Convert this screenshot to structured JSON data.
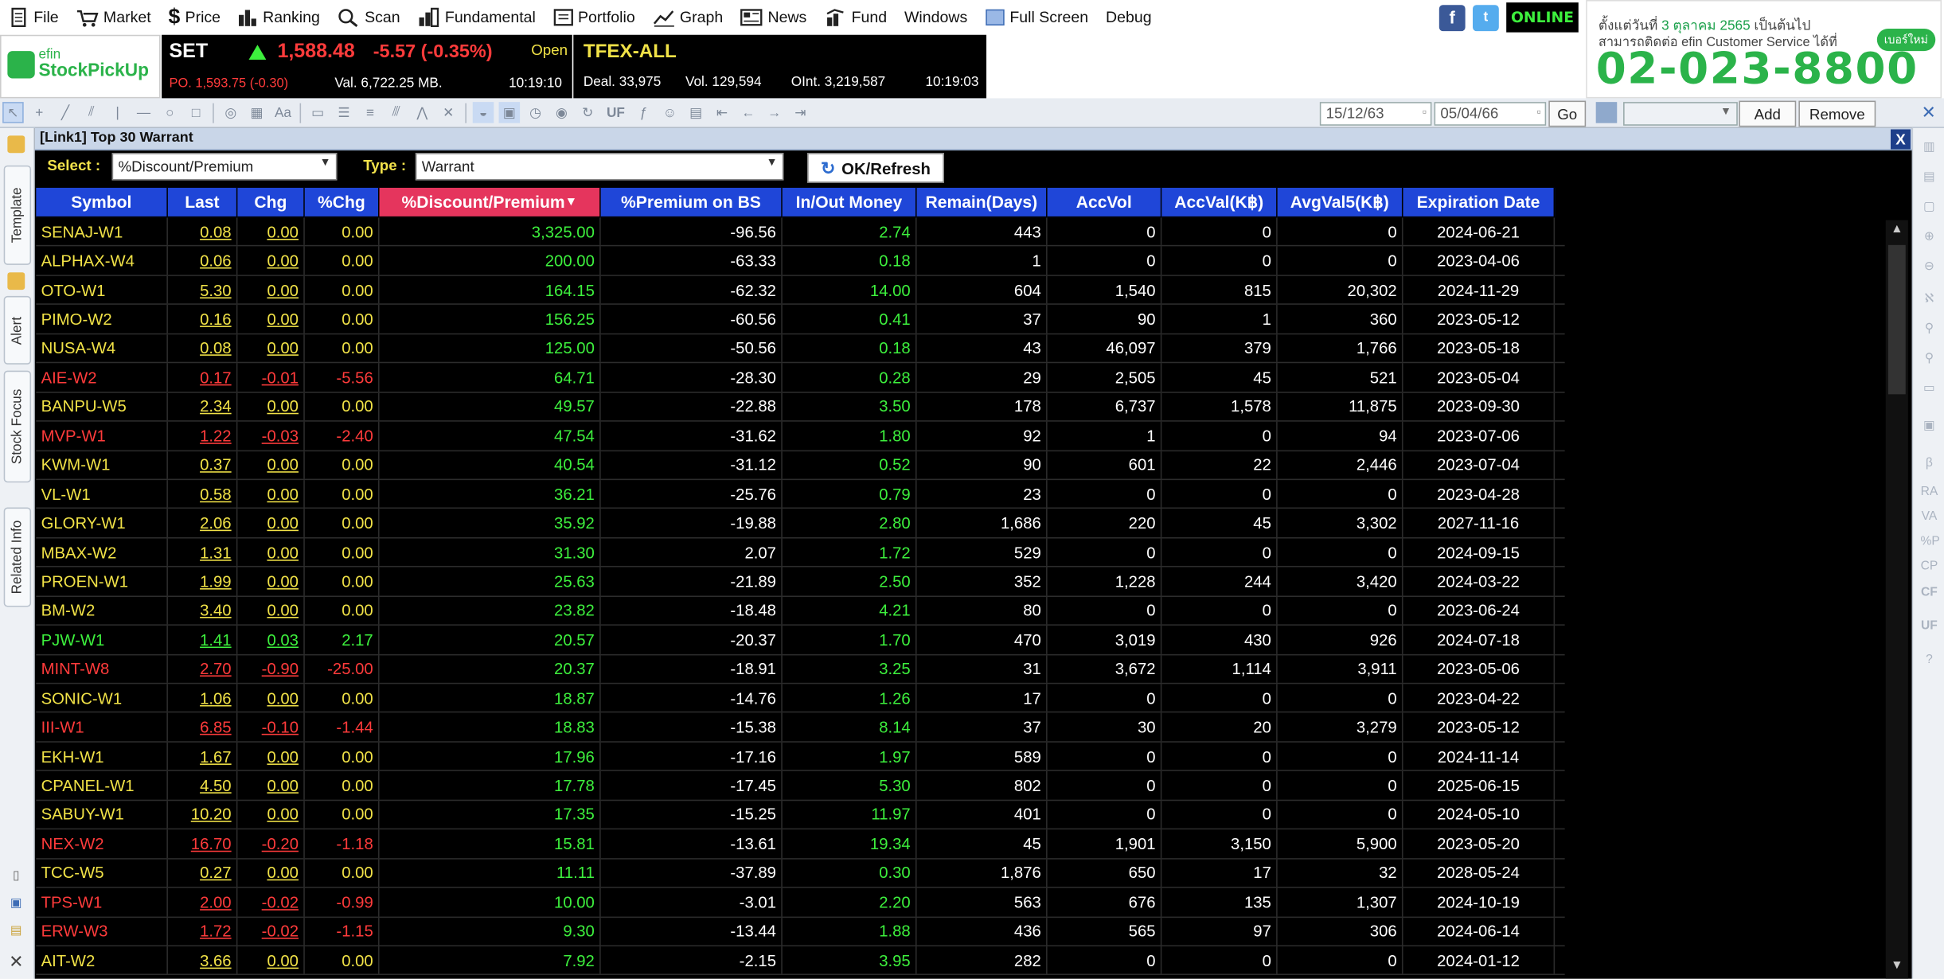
{
  "menu": {
    "file": "File",
    "market": "Market",
    "price": "Price",
    "ranking": "Ranking",
    "scan": "Scan",
    "fundamental": "Fundamental",
    "portfolio": "Portfolio",
    "graph": "Graph",
    "news": "News",
    "fund": "Fund",
    "windows": "Windows",
    "fullscreen": "Full Screen",
    "debug": "Debug",
    "online": "ONLINE"
  },
  "ad": {
    "line1a": "ตั้งแต่วันที่ ",
    "line1b": "3 ตุลาคม 2565",
    "line1c": " เป็นต้นไป",
    "line2": "สามารถติดต่อ efin Customer Service ได้ที่",
    "phone": "02-023-8800",
    "badge": "เบอร์ใหม่"
  },
  "logo": {
    "top": "efin",
    "bottom": "StockPickUp"
  },
  "set": {
    "name": "SET",
    "index": "1,588.48",
    "change": "-5.57 (-0.35%)",
    "status": "Open",
    "po": "PO. 1,593.75 (-0.30)",
    "value": "Val. 6,722.25 MB.",
    "time": "10:19:10"
  },
  "tfex": {
    "name": "TFEX-ALL",
    "deal": "Deal. 33,975",
    "vol": "Vol. 129,594",
    "oint": "OInt. 3,219,587",
    "time": "10:19:03"
  },
  "toolbar": {
    "uf": "UF",
    "date_from": "15/12/63",
    "date_to": "05/04/66",
    "go": "Go",
    "add": "Add",
    "remove": "Remove"
  },
  "left_tabs": [
    "Template",
    "Alert",
    "Stock Focus",
    "Related Info"
  ],
  "right_icons": [
    "RA",
    "VA",
    "%P",
    "CP",
    "CF",
    "UF"
  ],
  "panel": {
    "title": "[Link1] Top 30 Warrant",
    "close": "X",
    "select_label": "Select :",
    "select_value": "%Discount/Premium",
    "type_label": "Type :",
    "type_value": "Warrant",
    "ok_label": "OK/Refresh"
  },
  "columns": [
    "Symbol",
    "Last",
    "Chg",
    "%Chg",
    "%Discount/Premium",
    "%Premium on BS",
    "In/Out Money",
    "Remain(Days)",
    "AccVol",
    "AccVal(K฿)",
    "AvgVal5(K฿)",
    "Expiration Date"
  ],
  "rows": [
    [
      "SENAJ-W1",
      "0.08",
      "0.00",
      "0.00",
      "3,325.00",
      "-96.56",
      "2.74",
      "443",
      "0",
      "0",
      "0",
      "2024-06-21",
      "y"
    ],
    [
      "ALPHAX-W4",
      "0.06",
      "0.00",
      "0.00",
      "200.00",
      "-63.33",
      "0.18",
      "1",
      "0",
      "0",
      "0",
      "2023-04-06",
      "y"
    ],
    [
      "OTO-W1",
      "5.30",
      "0.00",
      "0.00",
      "164.15",
      "-62.32",
      "14.00",
      "604",
      "1,540",
      "815",
      "20,302",
      "2024-11-29",
      "y"
    ],
    [
      "PIMO-W2",
      "0.16",
      "0.00",
      "0.00",
      "156.25",
      "-60.56",
      "0.41",
      "37",
      "90",
      "1",
      "360",
      "2023-05-12",
      "y"
    ],
    [
      "NUSA-W4",
      "0.08",
      "0.00",
      "0.00",
      "125.00",
      "-50.56",
      "0.18",
      "43",
      "46,097",
      "379",
      "1,766",
      "2023-05-18",
      "y"
    ],
    [
      "AIE-W2",
      "0.17",
      "-0.01",
      "-5.56",
      "64.71",
      "-28.30",
      "0.28",
      "29",
      "2,505",
      "45",
      "521",
      "2023-05-04",
      "r"
    ],
    [
      "BANPU-W5",
      "2.34",
      "0.00",
      "0.00",
      "49.57",
      "-22.88",
      "3.50",
      "178",
      "6,737",
      "1,578",
      "11,875",
      "2023-09-30",
      "y"
    ],
    [
      "MVP-W1",
      "1.22",
      "-0.03",
      "-2.40",
      "47.54",
      "-31.62",
      "1.80",
      "92",
      "1",
      "0",
      "94",
      "2023-07-06",
      "r"
    ],
    [
      "KWM-W1",
      "0.37",
      "0.00",
      "0.00",
      "40.54",
      "-31.12",
      "0.52",
      "90",
      "601",
      "22",
      "2,446",
      "2023-07-04",
      "y"
    ],
    [
      "VL-W1",
      "0.58",
      "0.00",
      "0.00",
      "36.21",
      "-25.76",
      "0.79",
      "23",
      "0",
      "0",
      "0",
      "2023-04-28",
      "y"
    ],
    [
      "GLORY-W1",
      "2.06",
      "0.00",
      "0.00",
      "35.92",
      "-19.88",
      "2.80",
      "1,686",
      "220",
      "45",
      "3,302",
      "2027-11-16",
      "y"
    ],
    [
      "MBAX-W2",
      "1.31",
      "0.00",
      "0.00",
      "31.30",
      "2.07",
      "1.72",
      "529",
      "0",
      "0",
      "0",
      "2024-09-15",
      "y"
    ],
    [
      "PROEN-W1",
      "1.99",
      "0.00",
      "0.00",
      "25.63",
      "-21.89",
      "2.50",
      "352",
      "1,228",
      "244",
      "3,420",
      "2024-03-22",
      "y"
    ],
    [
      "BM-W2",
      "3.40",
      "0.00",
      "0.00",
      "23.82",
      "-18.48",
      "4.21",
      "80",
      "0",
      "0",
      "0",
      "2023-06-24",
      "y"
    ],
    [
      "PJW-W1",
      "1.41",
      "0.03",
      "2.17",
      "20.57",
      "-20.37",
      "1.70",
      "470",
      "3,019",
      "430",
      "926",
      "2024-07-18",
      "g"
    ],
    [
      "MINT-W8",
      "2.70",
      "-0.90",
      "-25.00",
      "20.37",
      "-18.91",
      "3.25",
      "31",
      "3,672",
      "1,114",
      "3,911",
      "2023-05-06",
      "r"
    ],
    [
      "SONIC-W1",
      "1.06",
      "0.00",
      "0.00",
      "18.87",
      "-14.76",
      "1.26",
      "17",
      "0",
      "0",
      "0",
      "2023-04-22",
      "y"
    ],
    [
      "III-W1",
      "6.85",
      "-0.10",
      "-1.44",
      "18.83",
      "-15.38",
      "8.14",
      "37",
      "30",
      "20",
      "3,279",
      "2023-05-12",
      "r"
    ],
    [
      "EKH-W1",
      "1.67",
      "0.00",
      "0.00",
      "17.96",
      "-17.16",
      "1.97",
      "589",
      "0",
      "0",
      "0",
      "2024-11-14",
      "y"
    ],
    [
      "CPANEL-W1",
      "4.50",
      "0.00",
      "0.00",
      "17.78",
      "-17.45",
      "5.30",
      "802",
      "0",
      "0",
      "0",
      "2025-06-15",
      "y"
    ],
    [
      "SABUY-W1",
      "10.20",
      "0.00",
      "0.00",
      "17.35",
      "-15.25",
      "11.97",
      "401",
      "0",
      "0",
      "0",
      "2024-05-10",
      "y"
    ],
    [
      "NEX-W2",
      "16.70",
      "-0.20",
      "-1.18",
      "15.81",
      "-13.61",
      "19.34",
      "45",
      "1,901",
      "3,150",
      "5,900",
      "2023-05-20",
      "r"
    ],
    [
      "TCC-W5",
      "0.27",
      "0.00",
      "0.00",
      "11.11",
      "-37.89",
      "0.30",
      "1,876",
      "650",
      "17",
      "32",
      "2028-05-24",
      "y"
    ],
    [
      "TPS-W1",
      "2.00",
      "-0.02",
      "-0.99",
      "10.00",
      "-3.01",
      "2.20",
      "563",
      "676",
      "135",
      "1,307",
      "2024-10-19",
      "r"
    ],
    [
      "ERW-W3",
      "1.72",
      "-0.02",
      "-1.15",
      "9.30",
      "-13.44",
      "1.88",
      "436",
      "565",
      "97",
      "306",
      "2024-06-14",
      "r"
    ],
    [
      "AIT-W2",
      "3.66",
      "0.00",
      "0.00",
      "7.92",
      "-2.15",
      "3.95",
      "282",
      "0",
      "0",
      "0",
      "2024-01-12",
      "y"
    ]
  ],
  "colors": {
    "yellow": "#f1e247",
    "red": "#ff3b3b",
    "green": "#3df03d",
    "white": "#ffffff",
    "header": "#1f46d8",
    "active_header": "#e5355d"
  }
}
